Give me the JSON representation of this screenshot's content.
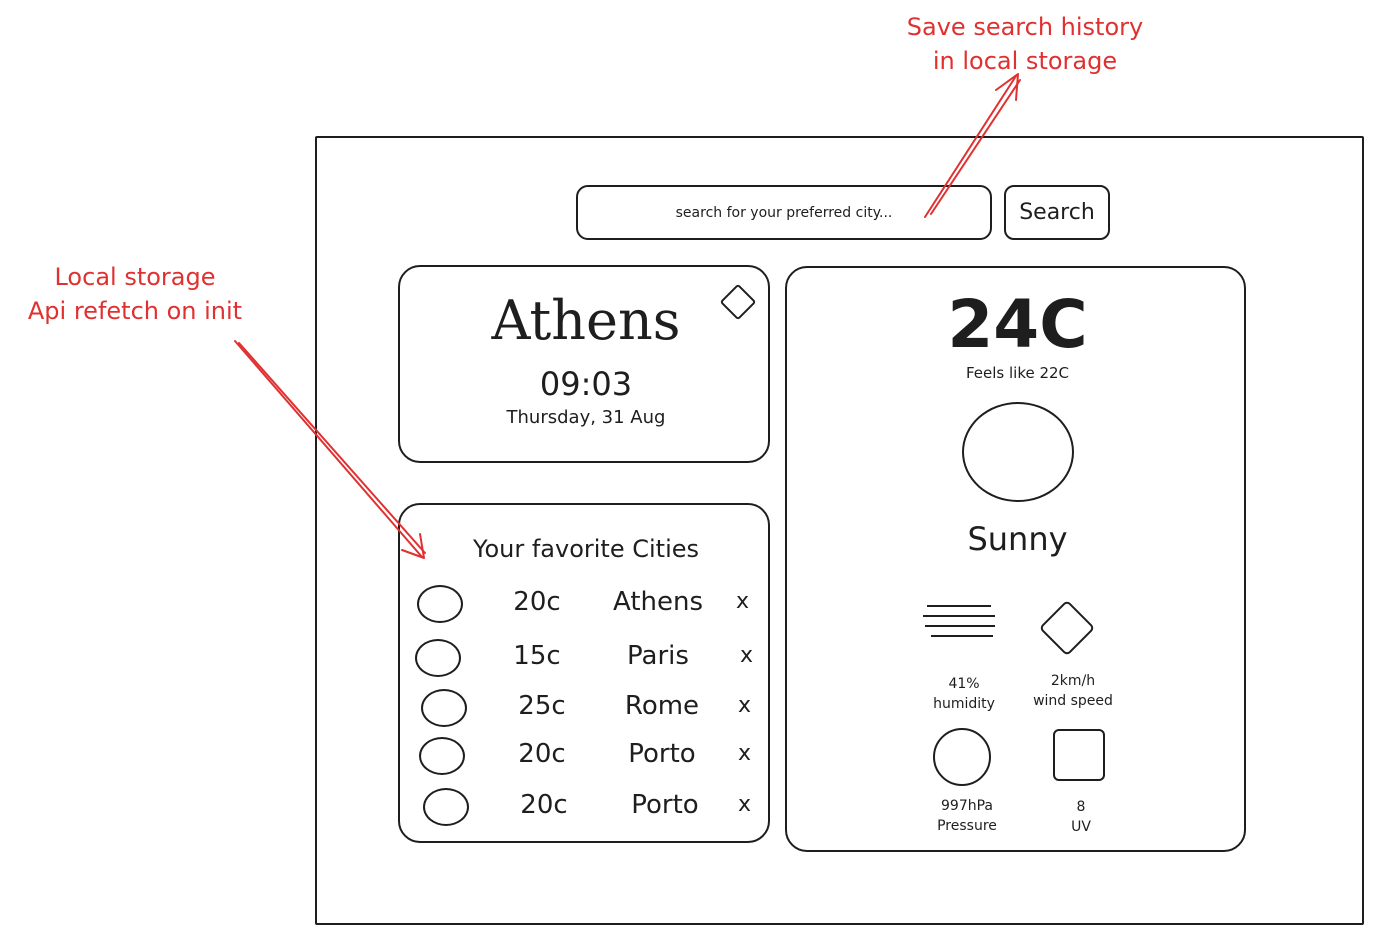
{
  "search": {
    "placeholder": "search for your preferred city...",
    "button_label": "Search"
  },
  "current_city": {
    "name": "Athens",
    "time": "09:03",
    "date": "Thursday, 31 Aug",
    "favorite_icon": "diamond-icon"
  },
  "favorites": {
    "title": "Your favorite Cities",
    "remove_label": "x",
    "items": [
      {
        "temp": "20c",
        "city": "Athens"
      },
      {
        "temp": "15c",
        "city": "Paris"
      },
      {
        "temp": "25c",
        "city": "Rome"
      },
      {
        "temp": "20c",
        "city": "Porto"
      },
      {
        "temp": "20c",
        "city": "Porto"
      }
    ]
  },
  "weather": {
    "temperature": "24C",
    "feels_like": "Feels like 22C",
    "condition": "Sunny",
    "condition_icon": "sun-icon",
    "stats": {
      "humidity": {
        "value": "41%",
        "label": "humidity",
        "icon": "humidity-icon"
      },
      "wind": {
        "value": "2km/h",
        "label": "wind speed",
        "icon": "wind-icon"
      },
      "pressure": {
        "value": "997hPa",
        "label": "Pressure",
        "icon": "pressure-icon"
      },
      "uv": {
        "value": "8",
        "label": "UV",
        "icon": "uv-icon"
      }
    }
  },
  "annotations": {
    "search_history_line1": "Save search history",
    "search_history_line2": "in local storage",
    "favorites_line1": "Local storage",
    "favorites_line2": "Api refetch on init",
    "color": "#e03131"
  }
}
